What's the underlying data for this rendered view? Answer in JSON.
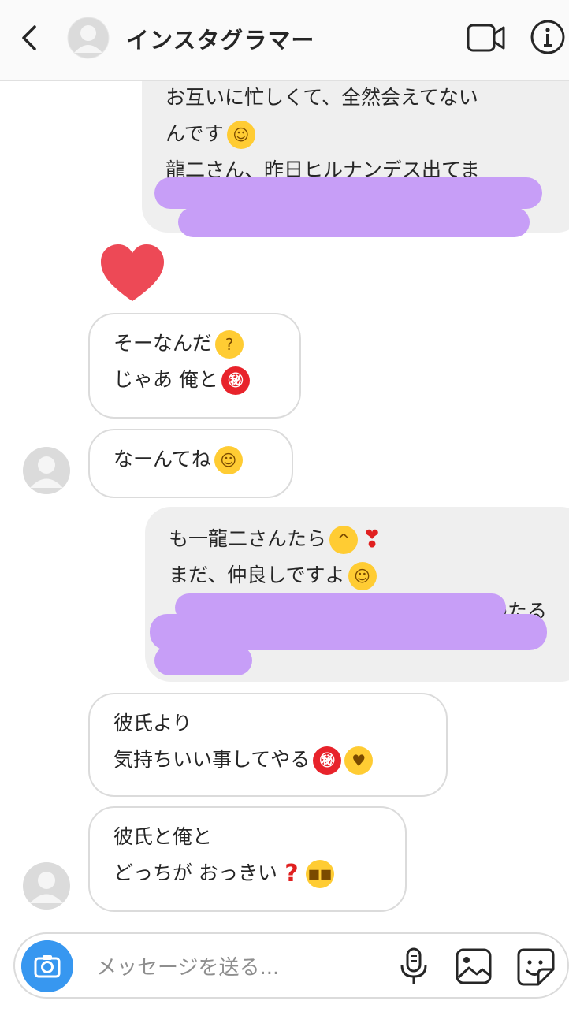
{
  "header": {
    "title": "インスタグラマー"
  },
  "messages": {
    "m1": {
      "line1": "お互いに忙しくて、全然会えてない",
      "line2": "んです",
      "line3": "龍二さん、昨日ヒルナンデス出てま"
    },
    "m2": {
      "line1": "そーなんだ",
      "line2": "じゃあ 俺と"
    },
    "m3": {
      "line1": "なーんてね"
    },
    "m4": {
      "line1": "も一龍二さんたら",
      "line2": "まだ、仲良しですよ",
      "line3_partial": "わたる"
    },
    "m5": {
      "line1": "彼氏より",
      "line2": "気持ちいい事してやる"
    },
    "m6": {
      "line1": "彼氏と俺と",
      "line2": "どっちが おっきい"
    }
  },
  "emoji": {
    "secret": "㊙"
  },
  "composer": {
    "placeholder": "メッセージを送る..."
  },
  "colors": {
    "accent": "#3797f0",
    "redaction": "#c79ef7",
    "heart": "#ed4956"
  }
}
